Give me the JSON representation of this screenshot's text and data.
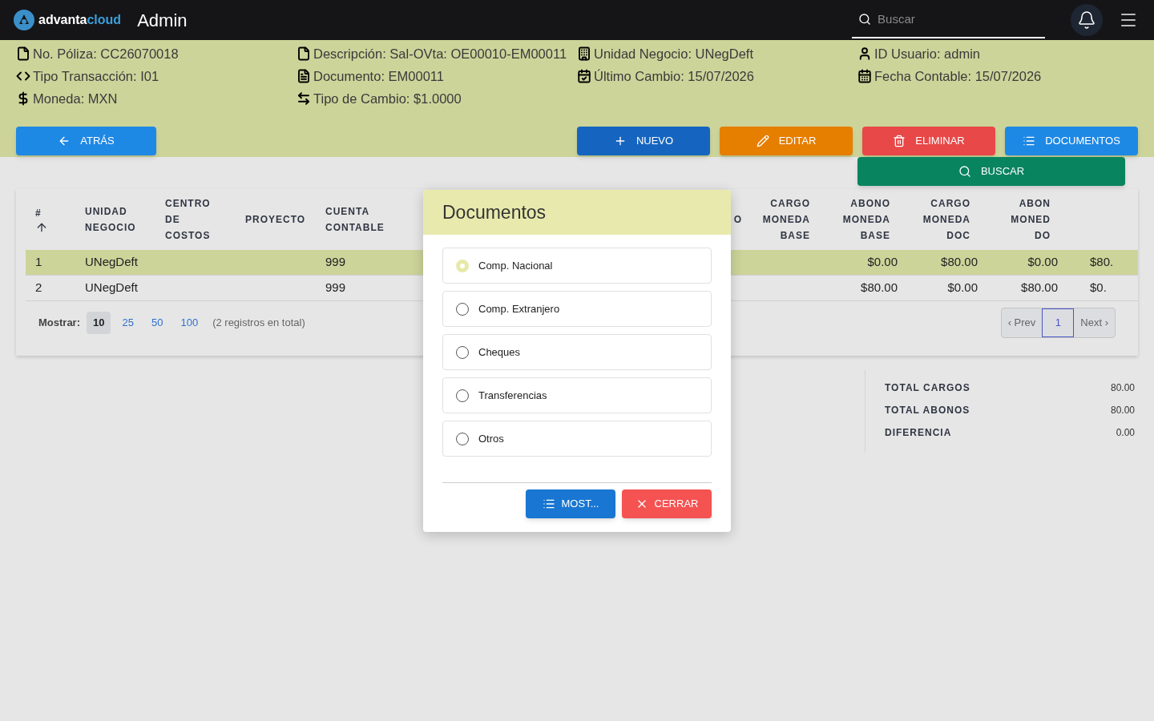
{
  "topbar": {
    "logo": [
      "advanta",
      "cloud"
    ],
    "title": "Admin",
    "search": {
      "placeholder": "Buscar"
    }
  },
  "info_columns": [
    [
      "No. Póliza: CC26070018",
      "Tipo Transacción: I01",
      "Moneda: MXN"
    ],
    [
      "Descripción: Sal-OVta: OE00010-EM00011",
      "Documento: EM00011",
      "Tipo de Cambio: $1.0000"
    ],
    [
      "Unidad Negocio: UNegDeft",
      "Último Cambio: 15/07/2026"
    ],
    [
      "ID Usuario: admin",
      "Fecha Contable: 15/07/2026"
    ]
  ],
  "toolbar": [
    {
      "kind": "back",
      "label": "ATRÁS"
    },
    {
      "kind": "new",
      "label": "NUEVO"
    },
    {
      "kind": "edit",
      "label": "EDITAR"
    },
    {
      "kind": "delete",
      "label": "ELIMINAR"
    },
    {
      "kind": "documents",
      "label": "DOCUMENTOS"
    },
    {
      "kind": "search",
      "label": "BUSCAR"
    }
  ],
  "table": {
    "columns": [
      [
        "#"
      ],
      [
        "UNIDAD",
        "NEGOCIO"
      ],
      [
        "CENTRO",
        "DE",
        "COSTOS"
      ],
      [
        "PROYECTO"
      ],
      [
        "CUENTA",
        "CONTABLE"
      ],
      [
        "O"
      ],
      [
        "CARGO",
        "MONEDA",
        "BASE"
      ],
      [
        "ABONO",
        "MONEDA",
        "BASE"
      ],
      [
        "CARGO",
        "MONEDA",
        "DOC"
      ],
      [
        "ABON",
        "MONED",
        "DO"
      ]
    ],
    "rows": [
      {
        "selected": true,
        "number": "1",
        "unidad_negocio": "UNegDeft",
        "cuenta_contable": "999",
        "amounts": [
          "$0.00",
          "$80.00",
          "$0.00",
          "$80."
        ]
      },
      {
        "selected": false,
        "number": "2",
        "unidad_negocio": "UNegDeft",
        "cuenta_contable": "999",
        "amounts": [
          "$80.00",
          "$0.00",
          "$80.00",
          "$0."
        ]
      }
    ],
    "show_label": "Mostrar:",
    "page_sizes": [
      {
        "label": "10",
        "selected": true
      },
      {
        "label": "25",
        "selected": false
      },
      {
        "label": "50",
        "selected": false
      },
      {
        "label": "100",
        "selected": false
      }
    ],
    "total_text": "(2 registros en total)",
    "pager": {
      "prev": "‹ Prev",
      "pages": [
        {
          "label": "1",
          "selected": true
        }
      ],
      "next": "Next ›"
    }
  },
  "totals": [
    {
      "label": "TOTAL CARGOS",
      "value": "80.00"
    },
    {
      "label": "TOTAL ABONOS",
      "value": "80.00"
    },
    {
      "label": "DIFERENCIA",
      "value": "0.00"
    }
  ],
  "modal": {
    "title": "Documentos",
    "options": [
      {
        "label": "Comp. Nacional",
        "selected": true
      },
      {
        "label": "Comp. Extranjero",
        "selected": false
      },
      {
        "label": "Cheques",
        "selected": false
      },
      {
        "label": "Transferencias",
        "selected": false
      },
      {
        "label": "Otros",
        "selected": false
      }
    ],
    "buttons": [
      {
        "kind": "show",
        "label": "MOST..."
      },
      {
        "kind": "close",
        "label": "CERRAR"
      }
    ]
  }
}
